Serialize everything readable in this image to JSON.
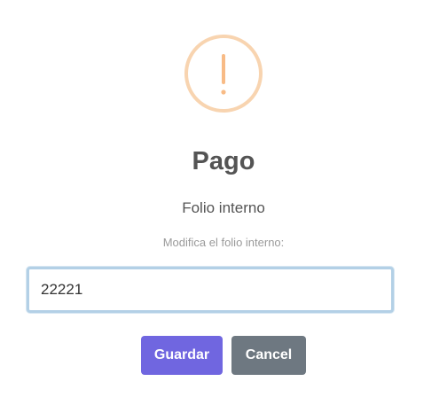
{
  "dialog": {
    "icon": "warning-exclamation-icon",
    "icon_color": "#f8bb86",
    "title": "Pago",
    "subtitle": "Folio interno",
    "input_label": "Modifica el folio interno:",
    "input_value": "22221",
    "buttons": {
      "save_label": "Guardar",
      "save_color": "#7066e0",
      "cancel_label": "Cancel",
      "cancel_color": "#6e7881"
    }
  }
}
